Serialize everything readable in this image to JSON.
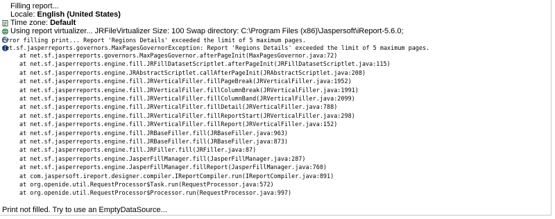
{
  "log": {
    "filling": "Filling report...",
    "locale_label": "Locale: ",
    "locale_value": "English (United States)",
    "timezone_label": "Time zone: ",
    "timezone_value": "Default",
    "virtualizer": "Using report virtualizer... JRFileVirtualizer Size: 100 Swap directory: C:\\Program Files (x86)\\Jaspersoft\\iReport-5.6.0;",
    "error_line": "Error filling print... Report 'Regions Details' exceeded the limit of 5 maximum pages.",
    "exception_line": "net.sf.jasperreports.governors.MaxPagesGovernorException: Report 'Regions Details' exceeded the limit of 5 maximum pages.",
    "stack_trace": [
      "at net.sf.jasperreports.governors.MaxPagesGovernor.afterPageInit(MaxPagesGovernor.java:72)",
      "at net.sf.jasperreports.engine.fill.JRFillDatasetScriptlet.afterPageInit(JRFillDatasetScriptlet.java:115)",
      "at net.sf.jasperreports.engine.JRAbstractScriptlet.callAfterPageInit(JRAbstractScriptlet.java:208)",
      "at net.sf.jasperreports.engine.fill.JRVerticalFiller.fillPageBreak(JRVerticalFiller.java:1952)",
      "at net.sf.jasperreports.engine.fill.JRVerticalFiller.fillColumnBreak(JRVerticalFiller.java:1991)",
      "at net.sf.jasperreports.engine.fill.JRVerticalFiller.fillColumnBand(JRVerticalFiller.java:2099)",
      "at net.sf.jasperreports.engine.fill.JRVerticalFiller.fillDetail(JRVerticalFiller.java:788)",
      "at net.sf.jasperreports.engine.fill.JRVerticalFiller.fillReportStart(JRVerticalFiller.java:298)",
      "at net.sf.jasperreports.engine.fill.JRVerticalFiller.fillReport(JRVerticalFiller.java:152)",
      "at net.sf.jasperreports.engine.fill.JRBaseFiller.fill(JRBaseFiller.java:963)",
      "at net.sf.jasperreports.engine.fill.JRBaseFiller.fill(JRBaseFiller.java:873)",
      "at net.sf.jasperreports.engine.fill.JRFiller.fill(JRFiller.java:87)",
      "at net.sf.jasperreports.engine.JasperFillManager.fill(JasperFillManager.java:287)",
      "at net.sf.jasperreports.engine.JasperFillManager.fillReport(JasperFillManager.java:760)",
      "at com.jaspersoft.ireport.designer.compiler.IReportCompiler.run(IReportCompiler.java:891)",
      "at org.openide.util.RequestProcessor$Task.run(RequestProcessor.java:572)",
      "at org.openide.util.RequestProcessor$Processor.run(RequestProcessor.java:997)"
    ],
    "footer": "Print not filled. Try to use an EmptyDataSource..."
  },
  "icons": {
    "filling": "report-page-icon",
    "locale": "globe-icon",
    "timezone": "clock-icon",
    "virtualizer": "info-icon"
  },
  "colors": {
    "globe": "#2a7a3a",
    "clock": "#3a66b8",
    "info": "#2f5fb5"
  }
}
